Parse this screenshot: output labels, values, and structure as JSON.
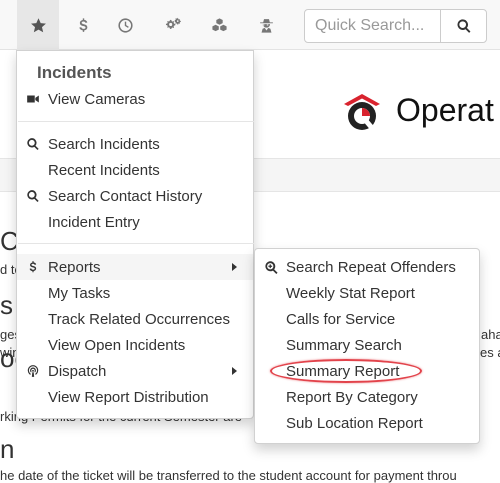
{
  "search": {
    "placeholder": "Quick Search..."
  },
  "nav": {
    "icons": [
      "star-icon",
      "dollar-icon",
      "clock-icon",
      "gears-icon",
      "cubes-icon",
      "user-secret-icon"
    ]
  },
  "brand": {
    "text": "Operat"
  },
  "background": {
    "frag_co": "CO",
    "frag_dto": "d to",
    "frag_s": "s",
    "frag_ges": "ges",
    "frag_win": "win",
    "frag_oo": "oo",
    "frag_parking": "rking Permits for the current Semester are",
    "frag_n": "n",
    "frag_ticket": "he date of the ticket will be transferred to the student account for payment throu",
    "frag_aha": "aha",
    "frag_esa": "es a"
  },
  "menu": {
    "header": "Incidents",
    "items": [
      {
        "label": "View Cameras",
        "icon": "video-camera-icon"
      },
      {
        "label": "Search Incidents",
        "icon": "search-icon"
      },
      {
        "label": "Recent Incidents",
        "icon": ""
      },
      {
        "label": "Search Contact History",
        "icon": "search-icon"
      },
      {
        "label": "Incident Entry",
        "icon": ""
      },
      {
        "label": "Reports",
        "icon": "dollar-icon"
      },
      {
        "label": "My Tasks",
        "icon": ""
      },
      {
        "label": "Track Related Occurrences",
        "icon": ""
      },
      {
        "label": "View Open Incidents",
        "icon": ""
      },
      {
        "label": "Dispatch",
        "icon": "podcast-icon"
      },
      {
        "label": "View Report Distribution",
        "icon": ""
      }
    ]
  },
  "submenu": {
    "items": [
      {
        "label": "Search Repeat Offenders",
        "icon": "search-plus-icon"
      },
      {
        "label": "Weekly Stat Report",
        "icon": ""
      },
      {
        "label": "Calls for Service",
        "icon": ""
      },
      {
        "label": "Summary Search",
        "icon": ""
      },
      {
        "label": "Summary Report",
        "icon": ""
      },
      {
        "label": "Report By Category",
        "icon": ""
      },
      {
        "label": "Sub Location Report",
        "icon": ""
      }
    ]
  },
  "colors": {
    "highlight_ring": "#e2434b",
    "logo_red": "#d9232e",
    "logo_dark": "#222222"
  }
}
